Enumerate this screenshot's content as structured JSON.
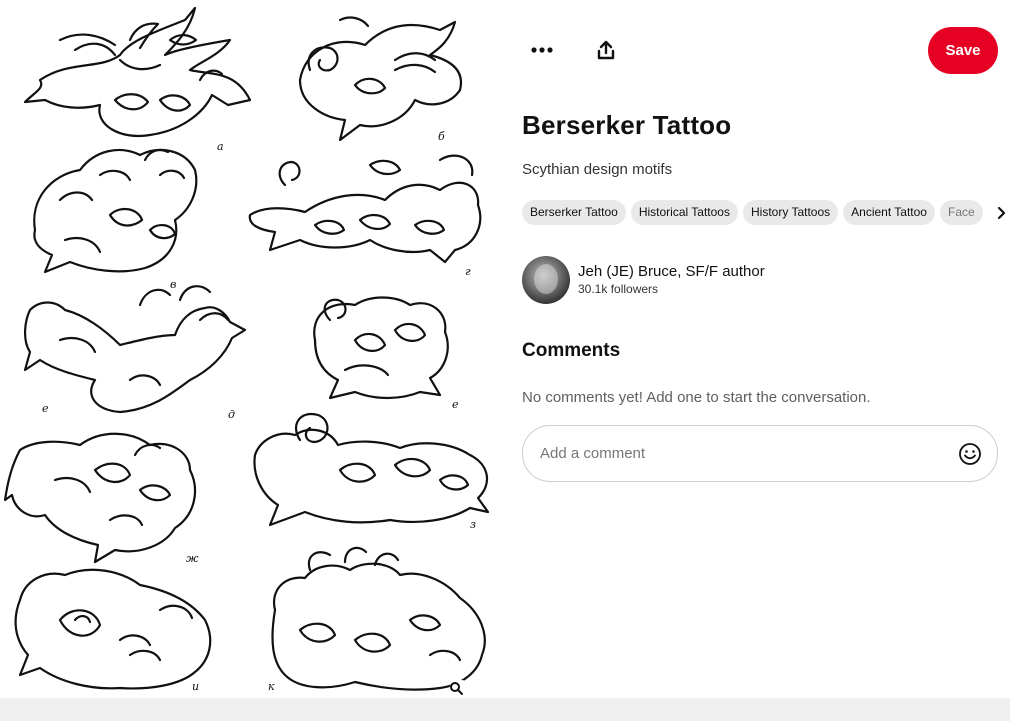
{
  "pin": {
    "title": "Berserker Tattoo",
    "description": "Scythian design motifs",
    "image_alt": "Scythian animal style drawings",
    "figure_letters": [
      "а",
      "б",
      "в",
      "г",
      "е",
      "д",
      "е",
      "ж",
      "з",
      "и",
      "к"
    ]
  },
  "toolbar": {
    "more_icon": "more-horizontal-icon",
    "share_icon": "share-upload-icon",
    "save_label": "Save"
  },
  "tags": [
    "Berserker Tattoo",
    "Historical Tattoos",
    "History Tattoos",
    "Ancient Tattoo",
    "Face"
  ],
  "creator": {
    "name": "Jeh (JE) Bruce, SF/F author",
    "followers": "30.1k followers"
  },
  "comments": {
    "title": "Comments",
    "empty_text": "No comments yet! Add one to start the conversation.",
    "placeholder": "Add a comment"
  },
  "colors": {
    "save_red": "#e60023",
    "tag_bg": "#e9e9e9",
    "bottom_bar": "#efefef"
  }
}
